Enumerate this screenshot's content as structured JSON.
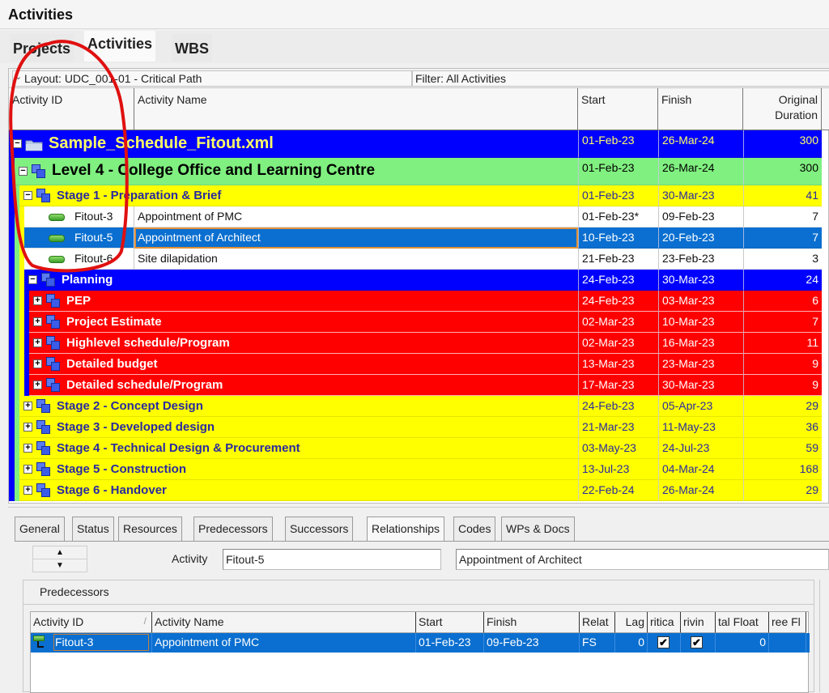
{
  "window": {
    "title": "Activities"
  },
  "top_tabs": [
    {
      "label": "Projects",
      "active": false
    },
    {
      "label": "Activities",
      "active": true
    },
    {
      "label": "WBS",
      "active": false
    }
  ],
  "toolbar": {
    "layout": "Layout: UDC_001-01 - Critical Path",
    "filter": "Filter: All Activities"
  },
  "columns": {
    "activity_id": "Activity ID",
    "activity_name": "Activity Name",
    "start": "Start",
    "finish": "Finish",
    "duration_line1": "Original",
    "duration_line2": "Duration"
  },
  "rows": [
    {
      "kind": "project",
      "level": 0,
      "expander": "-",
      "icon": "folder-icon",
      "id": "",
      "name": "Sample_Schedule_Fitout.xml",
      "start": "01-Feb-23",
      "finish": "26-Mar-24",
      "duration": "300",
      "bg": "#0000ff",
      "fg": "#ffff66"
    },
    {
      "kind": "wbs",
      "level": 1,
      "expander": "-",
      "icon": "wbs-icon",
      "id": "",
      "name": "Level 4 - College Office and Learning Centre",
      "start": "01-Feb-23",
      "finish": "26-Mar-24",
      "duration": "300",
      "bg": "#80f080",
      "fg": "#000000"
    },
    {
      "kind": "wbs",
      "level": 2,
      "expander": "-",
      "icon": "wbs-icon",
      "id": "",
      "name": "Stage 1 - Preparation & Brief",
      "start": "01-Feb-23",
      "finish": "30-Mar-23",
      "duration": "41",
      "bg": "#ffff00",
      "fg": "#2a2aa0"
    },
    {
      "kind": "activity",
      "level": 3,
      "icon": "activity-bar-icon",
      "id": "Fitout-3",
      "name": "Appointment of PMC",
      "start": "01-Feb-23*",
      "finish": "09-Feb-23",
      "duration": "7",
      "bg": "#ffffff",
      "fg": "#111111"
    },
    {
      "kind": "activity",
      "level": 3,
      "icon": "activity-bar-icon",
      "id": "Fitout-5",
      "name": "Appointment of Architect",
      "start": "10-Feb-23",
      "finish": "20-Feb-23",
      "duration": "7",
      "bg": "#0a6fd0",
      "fg": "#ffffff",
      "selected": true
    },
    {
      "kind": "activity",
      "level": 3,
      "icon": "activity-bar-icon",
      "id": "Fitout-6",
      "name": "Site dilapidation",
      "start": "21-Feb-23",
      "finish": "23-Feb-23",
      "duration": "3",
      "bg": "#ffffff",
      "fg": "#111111"
    },
    {
      "kind": "wbs",
      "level": 3,
      "expander": "-",
      "icon": "wbs-icon",
      "id": "",
      "name": "Planning",
      "start": "24-Feb-23",
      "finish": "30-Mar-23",
      "duration": "24",
      "bg": "#0000ff",
      "fg": "#ffffff"
    },
    {
      "kind": "wbs",
      "level": 4,
      "expander": "+",
      "icon": "wbs-icon",
      "id": "",
      "name": "PEP",
      "start": "24-Feb-23",
      "finish": "03-Mar-23",
      "duration": "6",
      "bg": "#ff0000",
      "fg": "#ffffff"
    },
    {
      "kind": "wbs",
      "level": 4,
      "expander": "+",
      "icon": "wbs-icon",
      "id": "",
      "name": "Project Estimate",
      "start": "02-Mar-23",
      "finish": "10-Mar-23",
      "duration": "7",
      "bg": "#ff0000",
      "fg": "#ffffff"
    },
    {
      "kind": "wbs",
      "level": 4,
      "expander": "+",
      "icon": "wbs-icon",
      "id": "",
      "name": "Highlevel schedule/Program",
      "start": "02-Mar-23",
      "finish": "16-Mar-23",
      "duration": "11",
      "bg": "#ff0000",
      "fg": "#ffffff"
    },
    {
      "kind": "wbs",
      "level": 4,
      "expander": "+",
      "icon": "wbs-icon",
      "id": "",
      "name": "Detailed budget",
      "start": "13-Mar-23",
      "finish": "23-Mar-23",
      "duration": "9",
      "bg": "#ff0000",
      "fg": "#ffffff"
    },
    {
      "kind": "wbs",
      "level": 4,
      "expander": "+",
      "icon": "wbs-icon",
      "id": "",
      "name": "Detailed schedule/Program",
      "start": "17-Mar-23",
      "finish": "30-Mar-23",
      "duration": "9",
      "bg": "#ff0000",
      "fg": "#ffffff"
    },
    {
      "kind": "wbs",
      "level": 2,
      "expander": "+",
      "icon": "wbs-icon",
      "id": "",
      "name": "Stage 2 - Concept Design",
      "start": "24-Feb-23",
      "finish": "05-Apr-23",
      "duration": "29",
      "bg": "#ffff00",
      "fg": "#2a2aa0"
    },
    {
      "kind": "wbs",
      "level": 2,
      "expander": "+",
      "icon": "wbs-icon",
      "id": "",
      "name": "Stage 3 - Developed design",
      "start": "21-Mar-23",
      "finish": "11-May-23",
      "duration": "36",
      "bg": "#ffff00",
      "fg": "#2a2aa0"
    },
    {
      "kind": "wbs",
      "level": 2,
      "expander": "+",
      "icon": "wbs-icon",
      "id": "",
      "name": "Stage 4 - Technical Design & Procurement",
      "start": "03-May-23",
      "finish": "24-Jul-23",
      "duration": "59",
      "bg": "#ffff00",
      "fg": "#2a2aa0"
    },
    {
      "kind": "wbs",
      "level": 2,
      "expander": "+",
      "icon": "wbs-icon",
      "id": "",
      "name": "Stage 5 - Construction",
      "start": "13-Jul-23",
      "finish": "04-Mar-24",
      "duration": "168",
      "bg": "#ffff00",
      "fg": "#2a2aa0"
    },
    {
      "kind": "wbs",
      "level": 2,
      "expander": "+",
      "icon": "wbs-icon",
      "id": "",
      "name": "Stage 6 - Handover",
      "start": "22-Feb-24",
      "finish": "26-Mar-24",
      "duration": "29",
      "bg": "#ffff00",
      "fg": "#2a2aa0"
    }
  ],
  "details": {
    "tabs": [
      {
        "label": "General",
        "active": false
      },
      {
        "label": "Status",
        "active": false
      },
      {
        "label": "Resources",
        "active": false
      },
      {
        "label": "Predecessors",
        "active": false
      },
      {
        "label": "Successors",
        "active": false
      },
      {
        "label": "Relationships",
        "active": true
      },
      {
        "label": "Codes",
        "active": false
      },
      {
        "label": "WPs & Docs",
        "active": false
      }
    ],
    "nav_up": "▲",
    "nav_down": "▼",
    "activity_label": "Activity",
    "activity_id": "Fitout-5",
    "activity_name": "Appointment of Architect",
    "predecessors_title": "Predecessors",
    "pred_columns": [
      "Activity ID",
      "Activity Name",
      "Start",
      "Finish",
      "Relat",
      "Lag",
      "ritica",
      "rivin",
      "tal Float",
      "ree Fl"
    ],
    "sort_indicator": "/",
    "pred_rows": [
      {
        "id": "Fitout-3",
        "name": "Appointment of PMC",
        "start": "01-Feb-23",
        "finish": "09-Feb-23",
        "relationship": "FS",
        "lag": "0",
        "critical": true,
        "driving": true,
        "total_float": "0",
        "free_float": ""
      }
    ]
  },
  "colors": {
    "selection": "#0a6fd0",
    "annotation": "#e01010"
  }
}
